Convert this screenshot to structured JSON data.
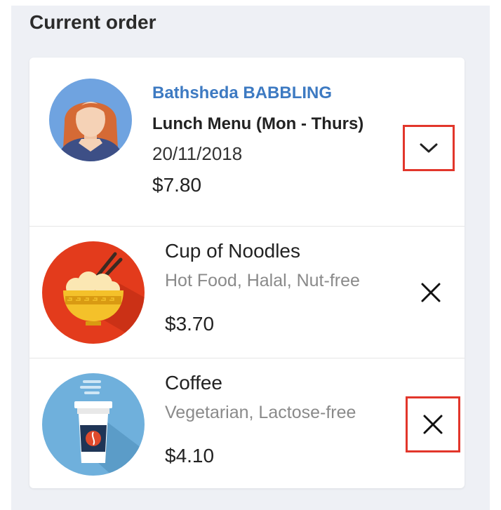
{
  "section": {
    "title": "Current order"
  },
  "order": {
    "customer_name": "Bathsheda BABBLING",
    "menu_name": "Lunch Menu (Mon - Thurs)",
    "date": "20/11/2018",
    "total": "$7.80",
    "expand_icon": "chevron-down-icon"
  },
  "items": [
    {
      "name": "Cup of Noodles",
      "tags": "Hot Food, Halal, Nut-free",
      "price": "$3.70",
      "image_icon": "noodles-bowl-icon",
      "remove_icon": "close-icon"
    },
    {
      "name": "Coffee",
      "tags": "Vegetarian, Lactose-free",
      "price": "$4.10",
      "image_icon": "coffee-cup-icon",
      "remove_icon": "close-icon"
    }
  ],
  "colors": {
    "accent_blue": "#3d7ac2",
    "highlight_red": "#e2362b",
    "panel_background": "#eef0f5"
  }
}
